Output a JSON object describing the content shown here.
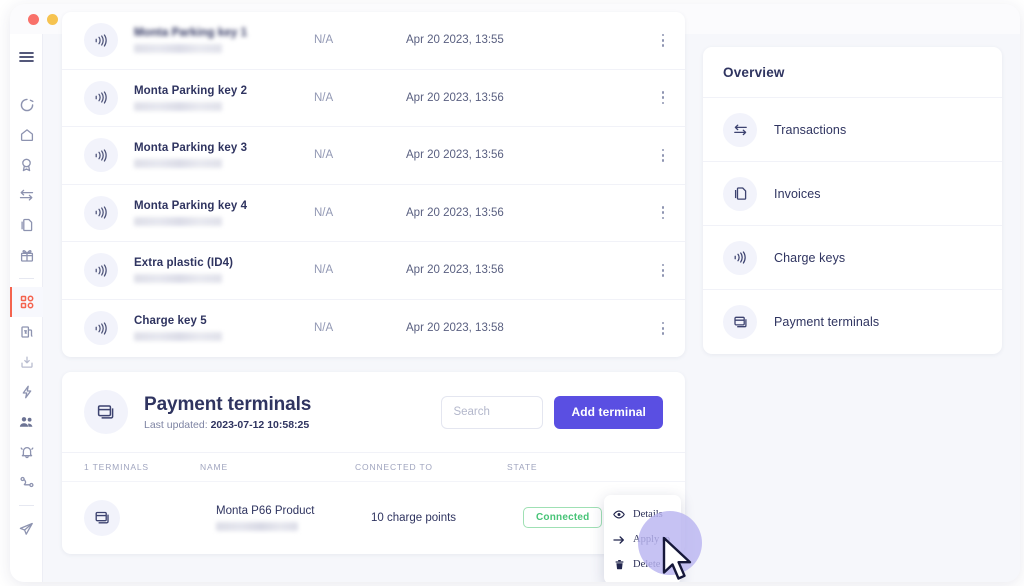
{
  "window": {
    "traffic_lights": [
      "close",
      "minimize",
      "maximize"
    ]
  },
  "sidebar": {
    "items": [
      {
        "name": "menu-toggle",
        "icon": "hamburger-icon",
        "active": false
      },
      {
        "name": "dashboard",
        "icon": "circle-progress-icon",
        "active": false
      },
      {
        "name": "home",
        "icon": "home-icon",
        "active": false
      },
      {
        "name": "awards",
        "icon": "badge-icon",
        "active": false
      },
      {
        "name": "transfers",
        "icon": "transfer-arrows-icon",
        "active": false
      },
      {
        "name": "documents",
        "icon": "documents-icon",
        "active": false
      },
      {
        "name": "gifts",
        "icon": "gift-icon",
        "active": false
      },
      {
        "name": "apps",
        "icon": "grid-apps-icon",
        "active": true
      },
      {
        "name": "charge-points",
        "icon": "charge-point-icon",
        "active": false
      },
      {
        "name": "inbox",
        "icon": "download-inbox-icon",
        "active": false
      },
      {
        "name": "energy",
        "icon": "lightning-bolt-icon",
        "active": false
      },
      {
        "name": "teams",
        "icon": "users-icon",
        "active": false
      },
      {
        "name": "alerts",
        "icon": "bell-icon",
        "active": false
      },
      {
        "name": "connectors",
        "icon": "connector-cable-icon",
        "active": false
      },
      {
        "name": "send",
        "icon": "paper-plane-icon",
        "active": false
      }
    ]
  },
  "charge_keys": {
    "rows": [
      {
        "name": "Monta Parking key 1",
        "na": "N/A",
        "date": "Apr 20 2023, 13:55"
      },
      {
        "name": "Monta Parking key 2",
        "na": "N/A",
        "date": "Apr 20 2023, 13:56"
      },
      {
        "name": "Monta Parking key 3",
        "na": "N/A",
        "date": "Apr 20 2023, 13:56"
      },
      {
        "name": "Monta Parking key 4",
        "na": "N/A",
        "date": "Apr 20 2023, 13:56"
      },
      {
        "name": "Extra plastic (ID4)",
        "na": "N/A",
        "date": "Apr 20 2023, 13:56"
      },
      {
        "name": "Charge key 5",
        "na": "N/A",
        "date": "Apr 20 2023, 13:58"
      }
    ]
  },
  "overview": {
    "title": "Overview",
    "items": [
      {
        "label": "Transactions",
        "icon": "transfer-arrows-icon"
      },
      {
        "label": "Invoices",
        "icon": "documents-icon"
      },
      {
        "label": "Charge keys",
        "icon": "nfc-waves-icon"
      },
      {
        "label": "Payment terminals",
        "icon": "terminal-cards-icon"
      }
    ]
  },
  "payment_terminals": {
    "title": "Payment terminals",
    "last_updated_label": "Last updated:",
    "last_updated_value": "2023-07-12 10:58:25",
    "search_placeholder": "Search",
    "search_value": "",
    "add_button": "Add terminal",
    "columns": {
      "count": "1 TERMINALS",
      "name": "NAME",
      "connected_to": "CONNECTED TO",
      "state": "STATE"
    },
    "rows": [
      {
        "name": "Monta P66 Product",
        "connected_to": "10 charge points",
        "state": "Connected",
        "state_color": "#47c477"
      }
    ]
  },
  "context_menu": {
    "items": [
      {
        "label": "Details",
        "icon": "eye-icon"
      },
      {
        "label": "Apply to",
        "icon": "arrow-right-icon"
      },
      {
        "label": "Delete",
        "icon": "trash-icon"
      }
    ]
  },
  "colors": {
    "accent_purple": "#5a4fe2",
    "active_sidebar": "#f4634e",
    "status_green": "#47c477",
    "text_dark": "#2f3460",
    "page_background": "#f6f7fb"
  }
}
